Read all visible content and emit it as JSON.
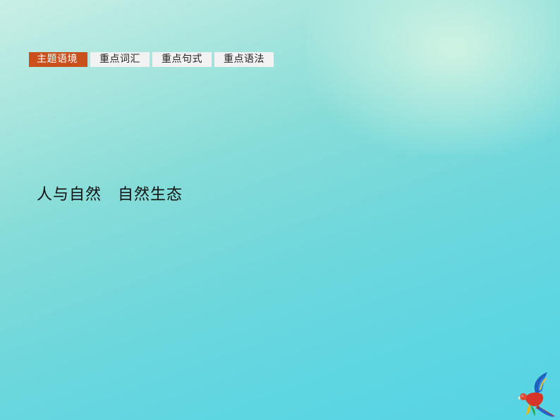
{
  "tabs": [
    {
      "label": "主题语境",
      "active": true
    },
    {
      "label": "重点词汇",
      "active": false
    },
    {
      "label": "重点句式",
      "active": false
    },
    {
      "label": "重点语法",
      "active": false
    }
  ],
  "main": {
    "headline": "人与自然　自然生态"
  },
  "decor": {
    "logo_icon": "parrot-icon"
  },
  "colors": {
    "active_tab": "#c9501d",
    "tab_background": "#f2f2f2",
    "background_top": "#c9efe6",
    "background_bottom": "#55d3e4"
  }
}
